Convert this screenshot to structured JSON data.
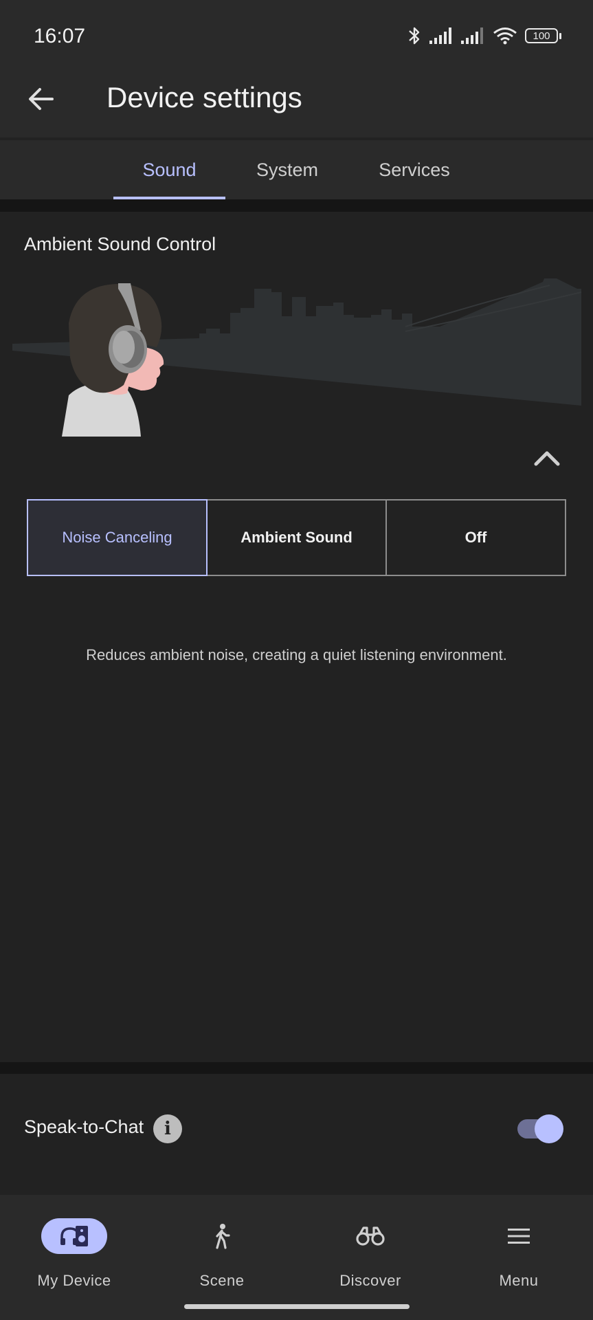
{
  "status_bar": {
    "time": "16:07",
    "battery": "100",
    "icons": [
      "bluetooth-icon",
      "signal-icon",
      "signal-icon",
      "wifi-icon",
      "battery-icon"
    ]
  },
  "header": {
    "title": "Device settings",
    "back_icon": "arrow-left-icon"
  },
  "tabs": [
    {
      "label": "Sound",
      "active": true
    },
    {
      "label": "System",
      "active": false
    },
    {
      "label": "Services",
      "active": false
    }
  ],
  "ambient": {
    "title": "Ambient Sound Control",
    "collapse_icon": "chevron-up-icon",
    "modes": [
      {
        "label": "Noise Canceling",
        "selected": true
      },
      {
        "label": "Ambient Sound",
        "selected": false
      },
      {
        "label": "Off",
        "selected": false
      }
    ],
    "description": "Reduces ambient noise, creating a quiet listening environment."
  },
  "speak_to_chat": {
    "label": "Speak-to-Chat",
    "info_icon": "info-icon",
    "enabled": true
  },
  "bottom_nav": [
    {
      "label": "My Device",
      "icon": "headphones-speaker-icon",
      "active": true
    },
    {
      "label": "Scene",
      "icon": "walking-person-icon",
      "active": false
    },
    {
      "label": "Discover",
      "icon": "binoculars-icon",
      "active": false
    },
    {
      "label": "Menu",
      "icon": "hamburger-icon",
      "active": false
    }
  ],
  "colors": {
    "accent": "#b8c0ff",
    "background": "#222222",
    "surface": "#2a2a2a"
  }
}
